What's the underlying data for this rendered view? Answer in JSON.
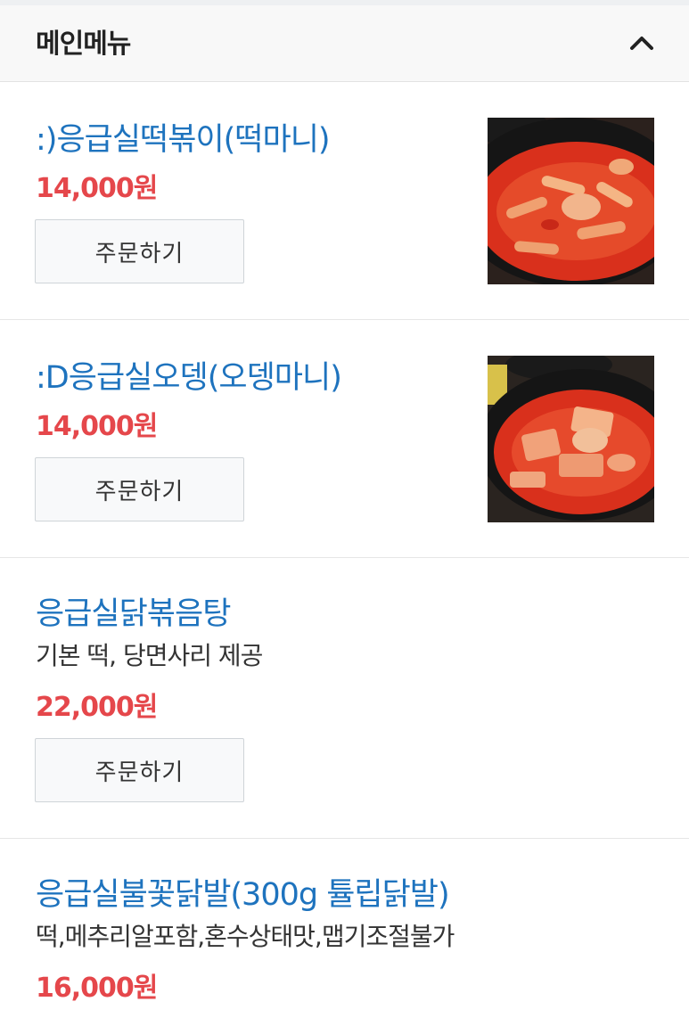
{
  "header": {
    "title": "메인메뉴",
    "collapse_icon": "chevron-up-icon"
  },
  "items": [
    {
      "name": ":)응급실떡볶이(떡마니)",
      "price": "14,000원",
      "order_label": "주문하기"
    },
    {
      "name": ":D응급실오뎅(오뎅마니)",
      "price": "14,000원",
      "order_label": "주문하기"
    },
    {
      "name": "응급실닭볶음탕",
      "description": "기본 떡, 당면사리 제공",
      "price": "22,000원",
      "order_label": "주문하기"
    },
    {
      "name": "응급실불꽃닭발(300g 튤립닭발)",
      "description": "떡,메추리알포함,혼수상태맛,맵기조절불가",
      "price": "16,000원"
    }
  ],
  "colors": {
    "name": "#1e73be",
    "price": "#e5474b",
    "header_bg": "#f8f8f8"
  }
}
